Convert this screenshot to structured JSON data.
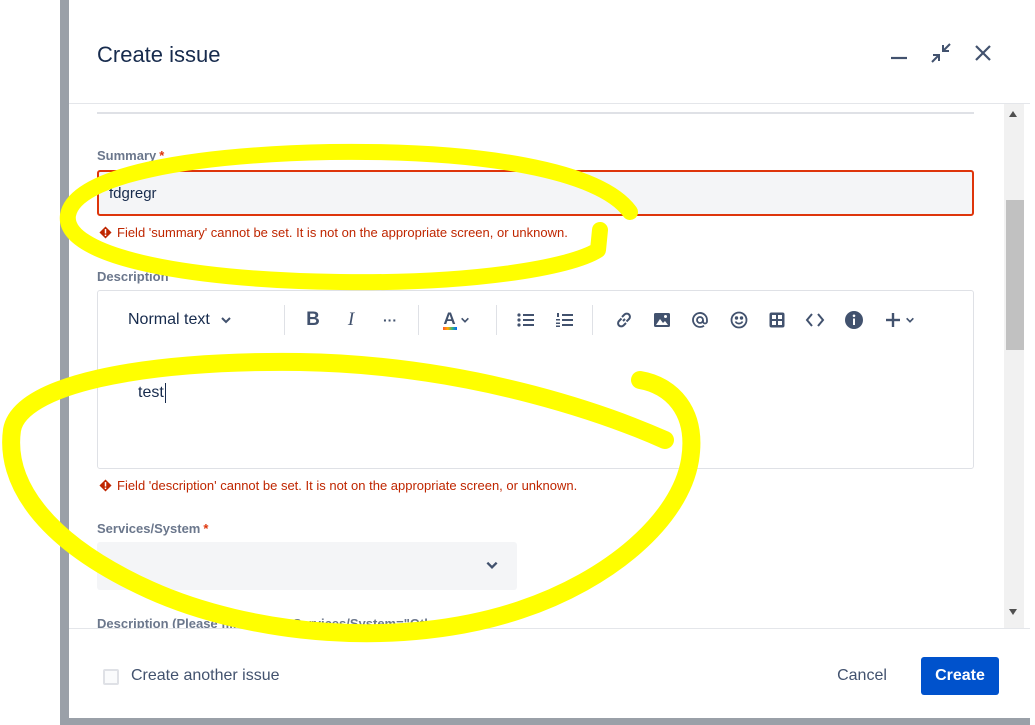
{
  "dialog": {
    "title": "Create issue",
    "minimize_icon": "minimize-icon",
    "shrink_icon": "shrink-icon",
    "close_icon": "close-icon"
  },
  "fields": {
    "summary": {
      "label": "Summary",
      "required_mark": "*",
      "value": "fdgregr",
      "error": "Field 'summary' cannot be set. It is not on the appropriate screen, or unknown."
    },
    "description": {
      "label": "Description",
      "required_mark": "*",
      "text_style": "Normal text",
      "content": "test",
      "error": "Field 'description' cannot be set. It is not on the appropriate screen, or unknown."
    },
    "services_system": {
      "label": "Services/System",
      "required_mark": "*",
      "value": ""
    },
    "description_other": {
      "label": "Description (Please fill-in when Services/System=\"Other\")"
    }
  },
  "toolbar": {
    "bold": "B",
    "italic": "I",
    "more": "···",
    "text_color": "A",
    "icons": [
      "bullet-list-icon",
      "numbered-list-icon",
      "link-icon",
      "image-icon",
      "mention-icon",
      "emoji-icon",
      "table-icon",
      "code-icon",
      "info-icon",
      "plus-icon"
    ]
  },
  "footer": {
    "create_another_label": "Create another issue",
    "cancel_label": "Cancel",
    "create_label": "Create"
  },
  "colors": {
    "primary": "#0052cc",
    "error": "#de350b",
    "highlight": "#ffff00"
  }
}
